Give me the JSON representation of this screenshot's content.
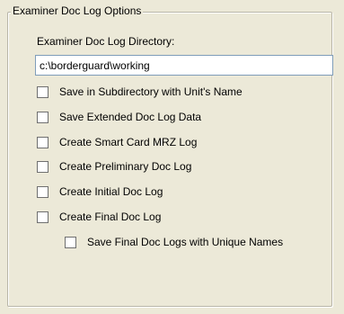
{
  "group": {
    "title": "Examiner Doc Log Options"
  },
  "directory": {
    "label": "Examiner Doc Log Directory:",
    "value": "c:\\borderguard\\working"
  },
  "options": [
    {
      "label": "Save in Subdirectory with Unit's Name",
      "checked": false
    },
    {
      "label": "Save Extended Doc Log Data",
      "checked": false
    },
    {
      "label": "Create Smart Card MRZ Log",
      "checked": false
    },
    {
      "label": "Create Preliminary Doc Log",
      "checked": false
    },
    {
      "label": "Create Initial Doc Log",
      "checked": false
    },
    {
      "label": "Create Final Doc Log",
      "checked": false
    },
    {
      "label": "Save Final Doc Logs with Unique Names",
      "checked": false
    }
  ]
}
